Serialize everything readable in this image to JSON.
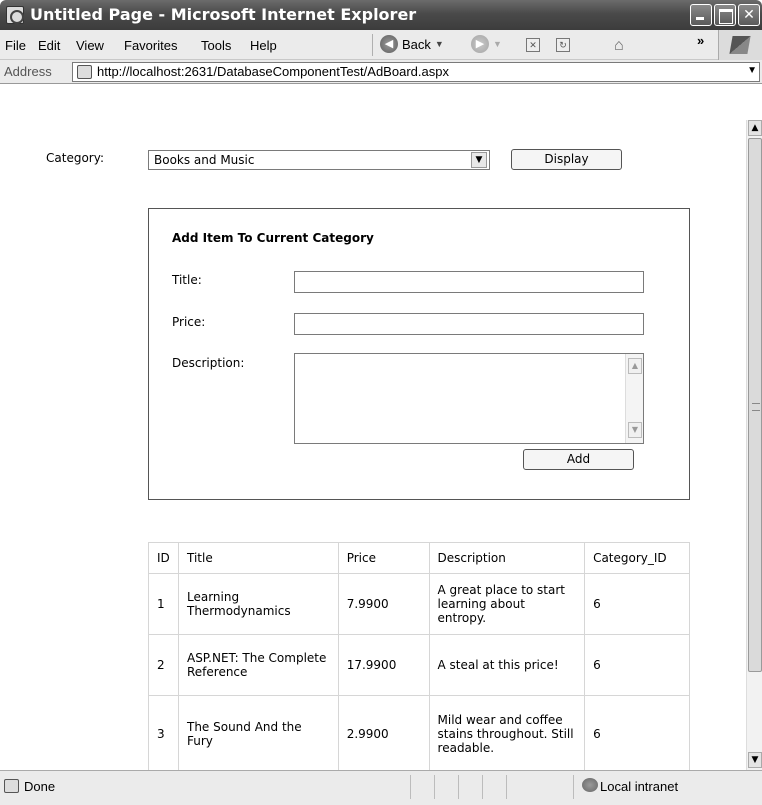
{
  "window": {
    "title": "Untitled Page - Microsoft Internet Explorer"
  },
  "menu": {
    "items": [
      "File",
      "Edit",
      "View",
      "Favorites",
      "Tools",
      "Help"
    ]
  },
  "toolbar": {
    "back_label": "Back"
  },
  "address": {
    "label": "Address",
    "url": "http://localhost:2631/DatabaseComponentTest/AdBoard.aspx"
  },
  "form": {
    "category_label": "Category:",
    "category_selected": "Books and Music",
    "display_button": "Display",
    "panel_heading": "Add Item To Current Category",
    "title_label": "Title:",
    "price_label": "Price:",
    "description_label": "Description:",
    "title_value": "",
    "price_value": "",
    "description_value": "",
    "add_button": "Add"
  },
  "grid": {
    "columns": [
      "ID",
      "Title",
      "Price",
      "Description",
      "Category_ID"
    ],
    "rows": [
      [
        "1",
        "Learning Thermodynamics",
        "7.9900",
        "A great place to start learning about entropy.",
        "6"
      ],
      [
        "2",
        "ASP.NET: The Complete Reference",
        "17.9900",
        "A steal at this price!",
        "6"
      ],
      [
        "3",
        "The Sound And the Fury",
        "2.9900",
        "Mild wear and coffee stains throughout. Still readable.",
        "6"
      ]
    ]
  },
  "status": {
    "text": "Done",
    "zone": "Local intranet"
  }
}
